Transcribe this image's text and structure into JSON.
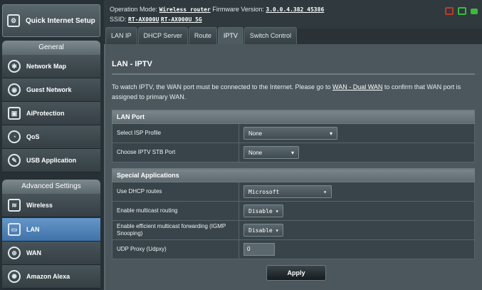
{
  "sidebar": {
    "quick_setup": "Quick Internet Setup",
    "general_head": "General",
    "general_items": [
      {
        "label": "Network Map",
        "icon": "network-map-icon"
      },
      {
        "label": "Guest Network",
        "icon": "guest-network-icon"
      },
      {
        "label": "AiProtection",
        "icon": "aiprotection-icon"
      },
      {
        "label": "QoS",
        "icon": "qos-icon"
      },
      {
        "label": "USB Application",
        "icon": "usb-application-icon"
      }
    ],
    "advanced_head": "Advanced Settings",
    "advanced_items": [
      {
        "label": "Wireless",
        "icon": "wireless-icon"
      },
      {
        "label": "LAN",
        "icon": "lan-icon",
        "active": true
      },
      {
        "label": "WAN",
        "icon": "wan-icon"
      },
      {
        "label": "Amazon Alexa",
        "icon": "amazon-alexa-icon"
      }
    ]
  },
  "topbar": {
    "operation_mode_label": "Operation Mode:",
    "operation_mode_value": "Wireless router",
    "firmware_label": "Firmware Version:",
    "firmware_value": "3.0.0.4.382_45386",
    "ssid_label": "SSID:",
    "ssid_1": "RT-AX000U",
    "ssid_2": "RT-AX000U_5G"
  },
  "tabs": [
    "LAN IP",
    "DHCP Server",
    "Route",
    "IPTV",
    "Switch Control"
  ],
  "active_tab": "IPTV",
  "main": {
    "title": "LAN - IPTV",
    "notice_text": "To watch IPTV, the WAN port must be connected to the Internet. Please go to",
    "notice_link": "WAN - Dual WAN",
    "notice_tail": "to confirm that WAN port is assigned to primary WAN."
  },
  "lan_port": {
    "header": "LAN Port",
    "isp_profile_label": "Select ISP Profile",
    "isp_profile_value": "None",
    "stb_port_label": "Choose IPTV STB Port",
    "stb_port_value": "None"
  },
  "special_apps": {
    "header": "Special Applications",
    "dhcp_routes_label": "Use DHCP routes",
    "dhcp_routes_value": "Microsoft",
    "multicast_label": "Enable multicast routing",
    "multicast_value": "Disable",
    "igmp_label": "Enable efficient multicast forwarding (IGMP Snooping)",
    "igmp_value": "Disable",
    "udpxy_label": "UDP Proxy (Udpxy)",
    "udpxy_value": "0"
  },
  "apply_label": "Apply",
  "colors": {
    "active_nav": "#4f84b9",
    "status_red": "#c0392b",
    "status_green": "#3cba3c"
  }
}
